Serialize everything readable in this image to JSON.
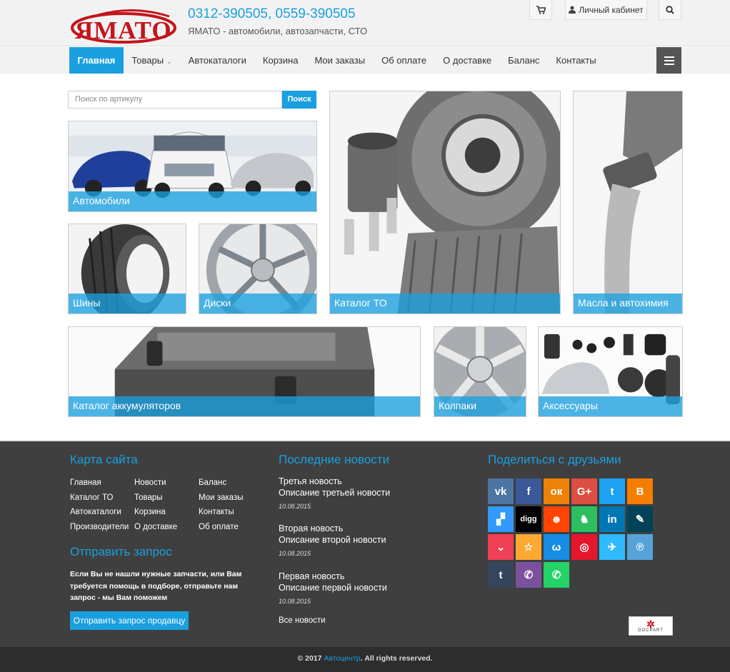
{
  "header": {
    "logo_text": "ЯМАТО",
    "phones": "0312-390505, 0559-390505",
    "tagline": "ЯМАТО - автомобили, автозапчасти, СТО",
    "cabinet_label": "Личный кабинет"
  },
  "nav": {
    "items": [
      {
        "label": "Главная"
      },
      {
        "label": "Товары"
      },
      {
        "label": "Автокаталоги"
      },
      {
        "label": "Корзина"
      },
      {
        "label": "Мои заказы"
      },
      {
        "label": "Об оплате"
      },
      {
        "label": "О доставке"
      },
      {
        "label": "Баланс"
      },
      {
        "label": "Контакты"
      }
    ],
    "active": "Главная"
  },
  "search": {
    "placeholder": "Поиск по артикулу",
    "button": "Поиск"
  },
  "tiles": {
    "cars": "Автомобили",
    "tires": "Шины",
    "wheels": "Диски",
    "maintenance": "Каталог ТО",
    "oils": "Масла и автохимия",
    "batteries": "Каталог аккумуляторов",
    "hubcaps": "Колпаки",
    "accessories": "Аксессуары"
  },
  "footer": {
    "sitemap_title": "Карта сайта",
    "sitemap_links": [
      "Главная",
      "Новости",
      "Баланс",
      "Каталог ТО",
      "Товары",
      "Мои заказы",
      "Автокаталоги",
      "Корзина",
      "Контакты",
      "Производители",
      "О доставке",
      "Об оплате"
    ],
    "request_title": "Отправить запрос",
    "request_text": "Если Вы не нашли нужные запчасти, или Вам требуется помощь в подборе, отправьте нам запрос - мы Вам поможем",
    "request_button": "Отправить запрос продавцу",
    "news_title": "Последние новости",
    "news": [
      {
        "title": "Третья новость",
        "desc": "Описание третьей новости",
        "date": "10.08.2015"
      },
      {
        "title": "Вторая новость",
        "desc": "Описание второй новости",
        "date": "10.08.2015"
      },
      {
        "title": "Первая новость",
        "desc": "Описание первой новости",
        "date": "10.08.2015"
      }
    ],
    "all_news": "Все новости",
    "share_title": "Поделиться с друзьями",
    "docpart_label": "DOCPART",
    "social": [
      {
        "name": "vk",
        "glyph": "vk",
        "color": "#4c75a3"
      },
      {
        "name": "facebook",
        "glyph": "f",
        "color": "#3b5998"
      },
      {
        "name": "odnoklassniki",
        "glyph": "ок",
        "color": "#ee8208"
      },
      {
        "name": "google-plus",
        "glyph": "G+",
        "color": "#dc4e41"
      },
      {
        "name": "twitter",
        "glyph": "t",
        "color": "#1da1f2"
      },
      {
        "name": "blogger",
        "glyph": "B",
        "color": "#f57d00"
      },
      {
        "name": "delicious",
        "glyph": "▞",
        "color": "#3399ff"
      },
      {
        "name": "digg",
        "glyph": "digg",
        "color": "#000000"
      },
      {
        "name": "reddit",
        "glyph": "☻",
        "color": "#ff4500"
      },
      {
        "name": "evernote",
        "glyph": "♞",
        "color": "#2dbe60"
      },
      {
        "name": "linkedin",
        "glyph": "in",
        "color": "#0077b5"
      },
      {
        "name": "livejournal",
        "glyph": "✎",
        "color": "#004359"
      },
      {
        "name": "pocket",
        "glyph": "⌄",
        "color": "#ef4056"
      },
      {
        "name": "mail-ru-star",
        "glyph": "☆",
        "color": "#ffa930"
      },
      {
        "name": "mail-ru",
        "glyph": "ω",
        "color": "#168de2"
      },
      {
        "name": "weibo",
        "glyph": "◎",
        "color": "#e6162d"
      },
      {
        "name": "surfingbird",
        "glyph": "✈",
        "color": "#30baff"
      },
      {
        "name": "pinme",
        "glyph": "℗",
        "color": "#56a3d9"
      },
      {
        "name": "tumblr",
        "glyph": "t",
        "color": "#35465c"
      },
      {
        "name": "viber",
        "glyph": "✆",
        "color": "#7b519d"
      },
      {
        "name": "whatsapp",
        "glyph": "✆",
        "color": "#25d366"
      }
    ]
  },
  "copyright": {
    "prefix": "© 2017",
    "link": "Автоцентр",
    "suffix": ". All rights reserved."
  }
}
